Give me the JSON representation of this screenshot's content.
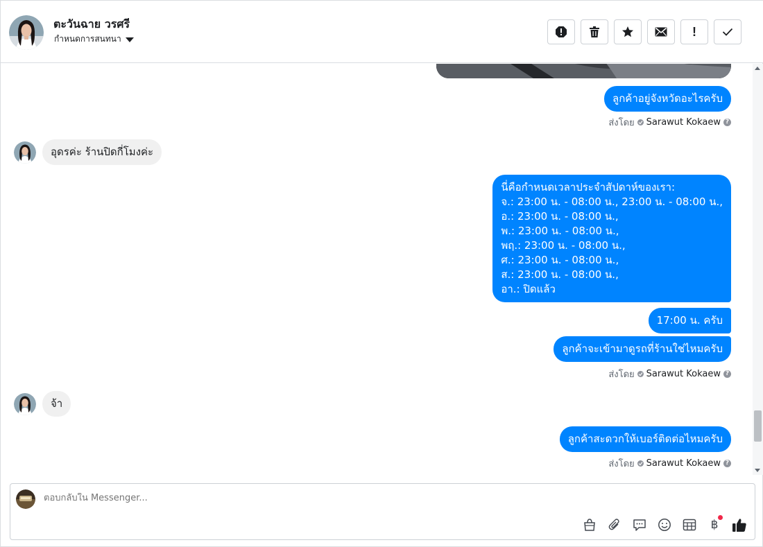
{
  "header": {
    "name": "ตะวันฉาย วรศรี",
    "assign_label": "กำหนดการสนทนา"
  },
  "actions": [
    {
      "icon": "spam-icon"
    },
    {
      "icon": "trash-icon"
    },
    {
      "icon": "star-icon"
    },
    {
      "icon": "mail-icon"
    },
    {
      "icon": "follow-up-icon",
      "glyph": "!"
    },
    {
      "icon": "checkmark-icon"
    }
  ],
  "messages": {
    "m1": "ลูกค้าอยู่จังหวัดอะไรครับ",
    "m2": "อุดรค่ะ ร้านปิดกี่โมงค่ะ",
    "m3_lines": [
      "นี่คือกำหนดเวลาประจำสัปดาห์ของเรา:",
      "จ.: 23:00 น. - 08:00 น., 23:00 น. - 08:00 น.,",
      "อ.: 23:00 น. - 08:00 น.,",
      "พ.: 23:00 น. - 08:00 น.,",
      "พฤ.: 23:00 น. - 08:00 น.,",
      "ศ.: 23:00 น. - 08:00 น.,",
      "ส.: 23:00 น. - 08:00 น.,",
      "อา.: ปิดแล้ว"
    ],
    "m4": "17:00 น. ครับ",
    "m5": "ลูกค้าจะเข้ามาดูรถที่ร้านใช่ไหมครับ",
    "m6": "จ้า",
    "m7": "ลูกค้าสะดวกให้เบอร์ติดต่อไหมครับ"
  },
  "sent_by": {
    "prefix": "ส่งโดย",
    "agent": "Sarawut Kokaew",
    "help": "?"
  },
  "composer": {
    "placeholder": "ตอบกลับใน Messenger..."
  },
  "tools": {
    "baht": "฿"
  },
  "colors": {
    "accent": "#0084ff",
    "incoming_bubble": "#f0f0f0",
    "notification": "#f02849"
  }
}
